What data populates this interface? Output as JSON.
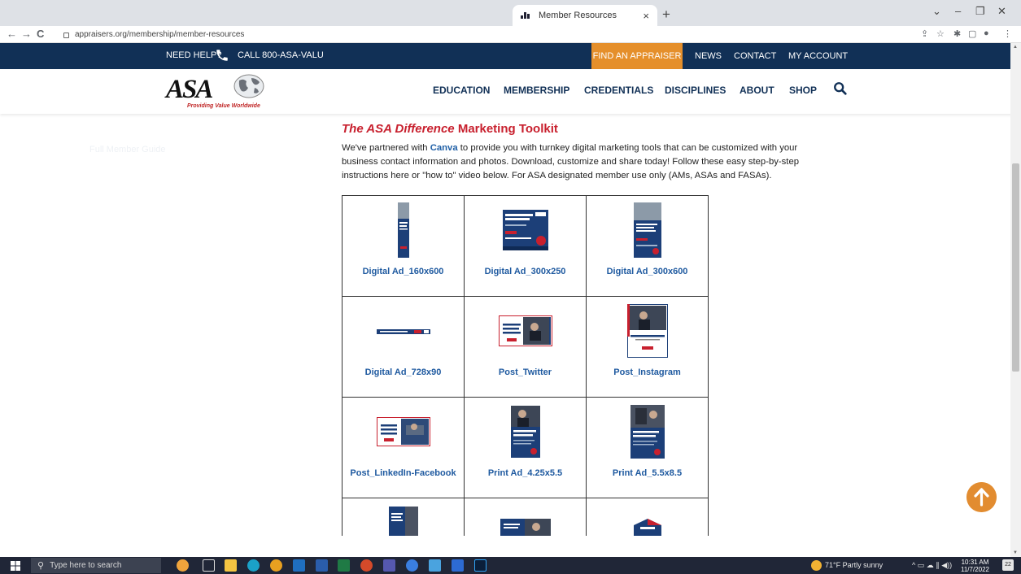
{
  "browser": {
    "tab_title": "Member Resources",
    "tab_close": "×",
    "new_tab": "+",
    "url": "appraisers.org/membership/member-resources",
    "back": "←",
    "forward": "→",
    "reload": "C",
    "win_min": "–",
    "win_max": "❐",
    "win_close": "✕",
    "tab_menu": "⌄"
  },
  "topbar": {
    "help": "NEED HELP?",
    "call": "CALL 800-ASA-VALU",
    "find": "FIND AN APPRAISER",
    "news": "NEWS",
    "contact": "CONTACT",
    "account": "MY ACCOUNT"
  },
  "logo": {
    "name": "ASA",
    "tagline": "Providing Value Worldwide"
  },
  "nav": {
    "education": "EDUCATION",
    "membership": "MEMBERSHIP",
    "credentials": "CREDENTIALS",
    "disciplines": "DISCIPLINES",
    "about": "ABOUT",
    "shop": "SHOP"
  },
  "sidebar": {
    "faded_link": "Full Member Guide"
  },
  "toolkit": {
    "title_italic": "The ASA Difference",
    "title_rest": " Marketing Toolkit",
    "intro_pre": "We've partnered with ",
    "canva": "Canva",
    "intro_post": " to provide you with turnkey digital marketing tools that can be customized with your business contact information and photos. Download, customize and share today! Follow these easy step-by-step instructions here or \"how to\" video below. For ASA designated member use only (AMs, ASAs and FASAs).",
    "items": [
      {
        "label": "Digital Ad_160x600",
        "thumb": "vertical-banner"
      },
      {
        "label": "Digital Ad_300x250",
        "thumb": "rectangle-banner"
      },
      {
        "label": "Digital Ad_300x600",
        "thumb": "half-page-banner"
      },
      {
        "label": "Digital Ad_728x90",
        "thumb": "leaderboard-banner"
      },
      {
        "label": "Post_Twitter",
        "thumb": "twitter-post"
      },
      {
        "label": "Post_Instagram",
        "thumb": "instagram-post"
      },
      {
        "label": "Post_LinkedIn-Facebook",
        "thumb": "linkedin-post"
      },
      {
        "label": "Print Ad_4.25x5.5",
        "thumb": "print-ad-small"
      },
      {
        "label": "Print Ad_5.5x8.5",
        "thumb": "print-ad-large"
      }
    ]
  },
  "taskbar": {
    "search_placeholder": "Type here to search",
    "weather": "71°F  Partly sunny",
    "time": "10:31 AM",
    "date": "11/7/2022",
    "notifications": "22"
  },
  "colors": {
    "navy": "#113056",
    "accent_orange": "#e58f2b",
    "title_red": "#c8202e",
    "link_blue": "#1f5aa0"
  }
}
